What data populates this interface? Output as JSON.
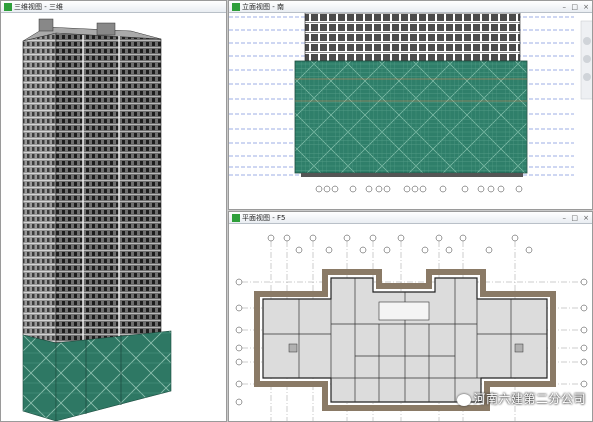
{
  "views": {
    "three_d": {
      "title": "三维视图 - 三维"
    },
    "elevation": {
      "title": "立面视图 - 南"
    },
    "plan": {
      "title": "平面视图 - F5"
    }
  },
  "window_controls": {
    "minimize": "–",
    "maximize": "□",
    "close": "×"
  },
  "watermark": {
    "text": "河南六建第二分公司"
  },
  "colors": {
    "glass_green": "#2f7f6a",
    "titlebar": "#eef1f5",
    "grid_line": "#3a5fcd"
  }
}
